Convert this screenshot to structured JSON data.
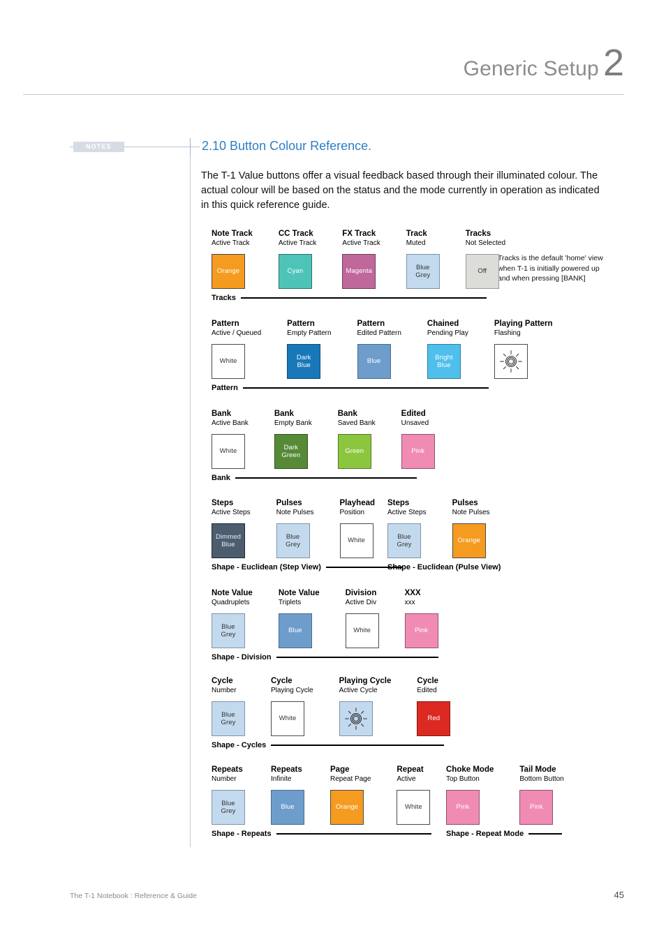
{
  "header": {
    "title": "Generic Setup",
    "chapter_number": "2"
  },
  "notes_marker": {
    "label": "NOTES"
  },
  "section": {
    "heading": "2.10 Button Colour Reference.",
    "intro": "The T-1 Value buttons offer a visual feedback based through their illuminated colour. The actual colour will be based on the status and the mode currently in operation as indicated in this quick reference guide."
  },
  "side_note": {
    "text": "Tracks is the default 'home' view\nwhen T-1 is initially powered up\nand when pressing [BANK]"
  },
  "colors": {
    "orange": "#F59B20",
    "cyan": "#4EC4B8",
    "magenta": "#C0689C",
    "blue_grey": "#C3D9ED",
    "off": "#DCDCD8",
    "white": "#FFFFFF",
    "dark_blue": "#1878B8",
    "blue": "#6E9DCC",
    "bright_blue": "#4FBFEC",
    "dark_green": "#568A36",
    "green": "#8CC63F",
    "pink": "#F08CB4",
    "dimmed_blue": "#4D5D70",
    "red": "#DC2A23"
  },
  "groups": [
    {
      "id": "tracks",
      "footer_label": "Tracks",
      "footer_rule_width": 352,
      "items": [
        {
          "title": "Note Track",
          "sub": "Active Track",
          "swatch_label": "Orange",
          "bg": "#F59B20",
          "fg": "#FFFFFF",
          "border": "#4a4a4a"
        },
        {
          "title": "CC Track",
          "sub": "Active Track",
          "swatch_label": "Cyan",
          "bg": "#4EC4B8",
          "fg": "#FFFFFF",
          "border": "#2e6f68"
        },
        {
          "title": "FX Track",
          "sub": "Active Track",
          "swatch_label": "Magenta",
          "bg": "#C0689C",
          "fg": "#FFFFFF",
          "border": "#6d3a57"
        },
        {
          "title": "Track",
          "sub": "Muted",
          "swatch_label": "Blue\nGrey",
          "bg": "#C3D9ED",
          "fg": "#333333",
          "border": "#7d93a8"
        },
        {
          "title": "Tracks",
          "sub": "Not Selected",
          "swatch_label": "Off",
          "bg": "#DCDCD8",
          "fg": "#333333",
          "border": "#9a9a96"
        }
      ]
    },
    {
      "id": "pattern",
      "footer_label": "Pattern",
      "footer_rule_width": 352,
      "items": [
        {
          "title": "Pattern",
          "sub": "Active / Queued",
          "swatch_label": "White",
          "bg": "#FFFFFF",
          "fg": "#333333",
          "border": "#4a4a4a"
        },
        {
          "title": "Pattern",
          "sub": "Empty Pattern",
          "swatch_label": "Dark\nBlue",
          "bg": "#1878B8",
          "fg": "#FFFFFF",
          "border": "#0f4d77"
        },
        {
          "title": "Pattern",
          "sub": "Edited Pattern",
          "swatch_label": "Blue",
          "bg": "#6E9DCC",
          "fg": "#FFFFFF",
          "border": "#486a8c"
        },
        {
          "title": "Chained",
          "sub": "Pending Play",
          "swatch_label": "Bright\nBlue",
          "bg": "#4FBFEC",
          "fg": "#FFFFFF",
          "border": "#2f7f9e"
        },
        {
          "title": "Playing Pattern",
          "sub": "Flashing",
          "swatch_label": "",
          "bg": "#FFFFFF",
          "fg": "#333333",
          "border": "#4a4a4a",
          "icon": "sunburst-icon"
        }
      ]
    },
    {
      "id": "bank",
      "footer_label": "Bank",
      "footer_rule_width": 260,
      "items": [
        {
          "title": "Bank",
          "sub": "Active Bank",
          "swatch_label": "White",
          "bg": "#FFFFFF",
          "fg": "#333333",
          "border": "#4a4a4a"
        },
        {
          "title": "Bank",
          "sub": "Empty Bank",
          "swatch_label": "Dark\nGreen",
          "bg": "#568A36",
          "fg": "#FFFFFF",
          "border": "#33521f"
        },
        {
          "title": "Bank",
          "sub": "Saved Bank",
          "swatch_label": "Green",
          "bg": "#8CC63F",
          "fg": "#FFFFFF",
          "border": "#55772a"
        },
        {
          "title": "Edited",
          "sub": "Unsaved",
          "swatch_label": "Pink",
          "bg": "#F08CB4",
          "fg": "#FFFFFF",
          "border": "#8f5069"
        }
      ]
    },
    {
      "id": "shape-euclidean-step",
      "footer_label": "Shape - Euclidean (Step View)",
      "footer_rule_width": 110,
      "items": [
        {
          "title": "Steps",
          "sub": "Active Steps",
          "swatch_label": "Dimmed\nBlue",
          "bg": "#4D5D70",
          "fg": "#E8EEF4",
          "border": "#1f2730"
        },
        {
          "title": "Pulses",
          "sub": "Note Pulses",
          "swatch_label": "Blue\nGrey",
          "bg": "#C3D9ED",
          "fg": "#333333",
          "border": "#7d93a8"
        },
        {
          "title": "Playhead",
          "sub": "Position",
          "swatch_label": "White",
          "bg": "#FFFFFF",
          "fg": "#333333",
          "border": "#4a4a4a"
        }
      ]
    },
    {
      "id": "shape-euclidean-pulse",
      "footer_label": "Shape - Euclidean (Pulse View)",
      "footer_rule_width": 0,
      "items": [
        {
          "title": "Steps",
          "sub": "Active Steps",
          "swatch_label": "Blue\nGrey",
          "bg": "#C3D9ED",
          "fg": "#333333",
          "border": "#7d93a8"
        },
        {
          "title": "Pulses",
          "sub": "Note Pulses",
          "swatch_label": "Orange",
          "bg": "#F59B20",
          "fg": "#FFFFFF",
          "border": "#4a4a4a"
        }
      ]
    },
    {
      "id": "shape-division",
      "footer_label": "Shape - Division",
      "footer_rule_width": 232,
      "items": [
        {
          "title": "Note Value",
          "sub": "Quadruplets",
          "swatch_label": "Blue\nGrey",
          "bg": "#C3D9ED",
          "fg": "#333333",
          "border": "#7d93a8"
        },
        {
          "title": "Note Value",
          "sub": "Triplets",
          "swatch_label": "Blue",
          "bg": "#6E9DCC",
          "fg": "#FFFFFF",
          "border": "#486a8c"
        },
        {
          "title": "Division",
          "sub": "Active Div",
          "swatch_label": "White",
          "bg": "#FFFFFF",
          "fg": "#333333",
          "border": "#4a4a4a"
        },
        {
          "title": "XXX",
          "sub": "xxx",
          "swatch_label": "Pink",
          "bg": "#F08CB4",
          "fg": "#FFFFFF",
          "border": "#8f5069"
        }
      ]
    },
    {
      "id": "shape-cycles",
      "footer_label": "Shape - Cycles",
      "footer_rule_width": 248,
      "items": [
        {
          "title": "Cycle",
          "sub": "Number",
          "swatch_label": "Blue\nGrey",
          "bg": "#C3D9ED",
          "fg": "#333333",
          "border": "#7d93a8"
        },
        {
          "title": "Cycle",
          "sub": "Playing Cycle",
          "swatch_label": "White",
          "bg": "#FFFFFF",
          "fg": "#333333",
          "border": "#4a4a4a"
        },
        {
          "title": "Playing Cycle",
          "sub": "Active Cycle",
          "swatch_label": "",
          "bg": "#C3D9ED",
          "fg": "#333333",
          "border": "#7d93a8",
          "icon": "sunburst-icon"
        },
        {
          "title": "Cycle",
          "sub": "Edited",
          "swatch_label": "Red",
          "bg": "#DC2A23",
          "fg": "#FFFFFF",
          "border": "#7e1813"
        }
      ]
    },
    {
      "id": "shape-repeats",
      "footer_label": "Shape - Repeats",
      "footer_rule_width": 222,
      "items": [
        {
          "title": "Repeats",
          "sub": "Number",
          "swatch_label": "Blue\nGrey",
          "bg": "#C3D9ED",
          "fg": "#333333",
          "border": "#7d93a8"
        },
        {
          "title": "Repeats",
          "sub": "Infinite",
          "swatch_label": "Blue",
          "bg": "#6E9DCC",
          "fg": "#FFFFFF",
          "border": "#486a8c"
        },
        {
          "title": "Page",
          "sub": "Repeat Page",
          "swatch_label": "Orange",
          "bg": "#F59B20",
          "fg": "#FFFFFF",
          "border": "#4a4a4a"
        },
        {
          "title": "Repeat",
          "sub": "Active",
          "swatch_label": "White",
          "bg": "#FFFFFF",
          "fg": "#333333",
          "border": "#4a4a4a"
        }
      ]
    },
    {
      "id": "shape-repeat-mode",
      "footer_label": "Shape - Repeat Mode",
      "footer_rule_width": 48,
      "items": [
        {
          "title": "Choke Mode",
          "sub": "Top Button",
          "swatch_label": "Pink",
          "bg": "#F08CB4",
          "fg": "#FFFFFF",
          "border": "#8f5069"
        },
        {
          "title": "Tail Mode",
          "sub": "Bottom Button",
          "swatch_label": "Pink",
          "bg": "#F08CB4",
          "fg": "#FFFFFF",
          "border": "#8f5069"
        }
      ]
    }
  ],
  "footer": {
    "text": "The T-1 Notebook : Reference & Guide",
    "page_number": "45"
  }
}
